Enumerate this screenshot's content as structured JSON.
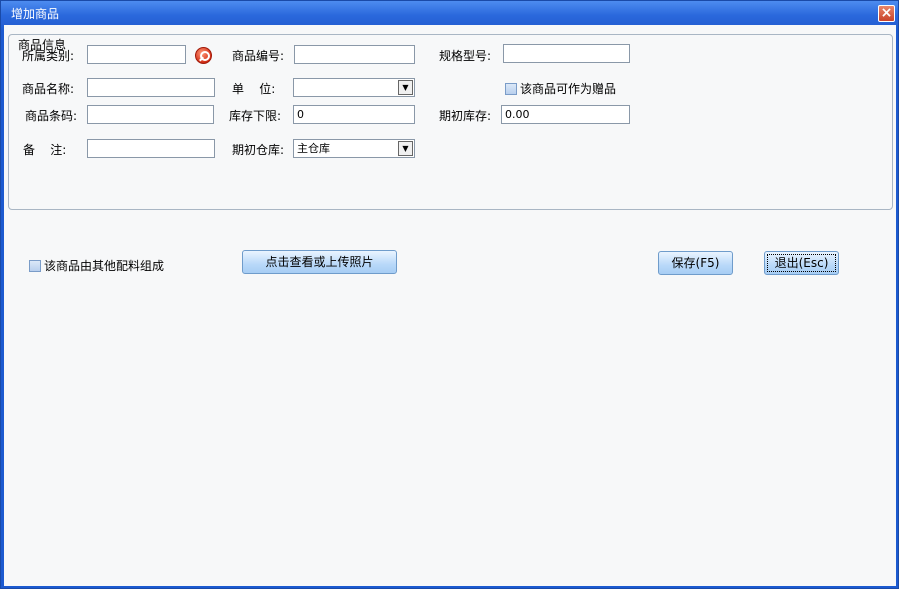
{
  "window": {
    "title": "增加商品",
    "close_glyph": "×"
  },
  "group": {
    "title": "商品信息"
  },
  "fields": {
    "category": {
      "label": "所属类别:",
      "value": ""
    },
    "code": {
      "label": "商品编号:",
      "value": ""
    },
    "spec": {
      "label": "规格型号:",
      "value": ""
    },
    "name": {
      "label": "商品名称:",
      "value": ""
    },
    "unit": {
      "label": "单    位:",
      "value": ""
    },
    "barcode": {
      "label": "商品条码:",
      "value": ""
    },
    "stock_min": {
      "label": "库存下限:",
      "value": "0"
    },
    "initial_stock": {
      "label": "期初库存:",
      "value": "0.00"
    },
    "remark": {
      "label": "备    注:",
      "value": ""
    },
    "warehouse": {
      "label": "期初仓库:",
      "value": "主仓库"
    }
  },
  "checkboxes": {
    "gift": {
      "label": "该商品可作为赠品",
      "checked": false
    },
    "composite": {
      "label": "该商品由其他配料组成",
      "checked": false
    }
  },
  "buttons": {
    "photo": "点击查看或上传照片",
    "save": "保存(F5)",
    "exit": "退出(Esc)"
  },
  "icons": {
    "category_search": "search-icon"
  }
}
